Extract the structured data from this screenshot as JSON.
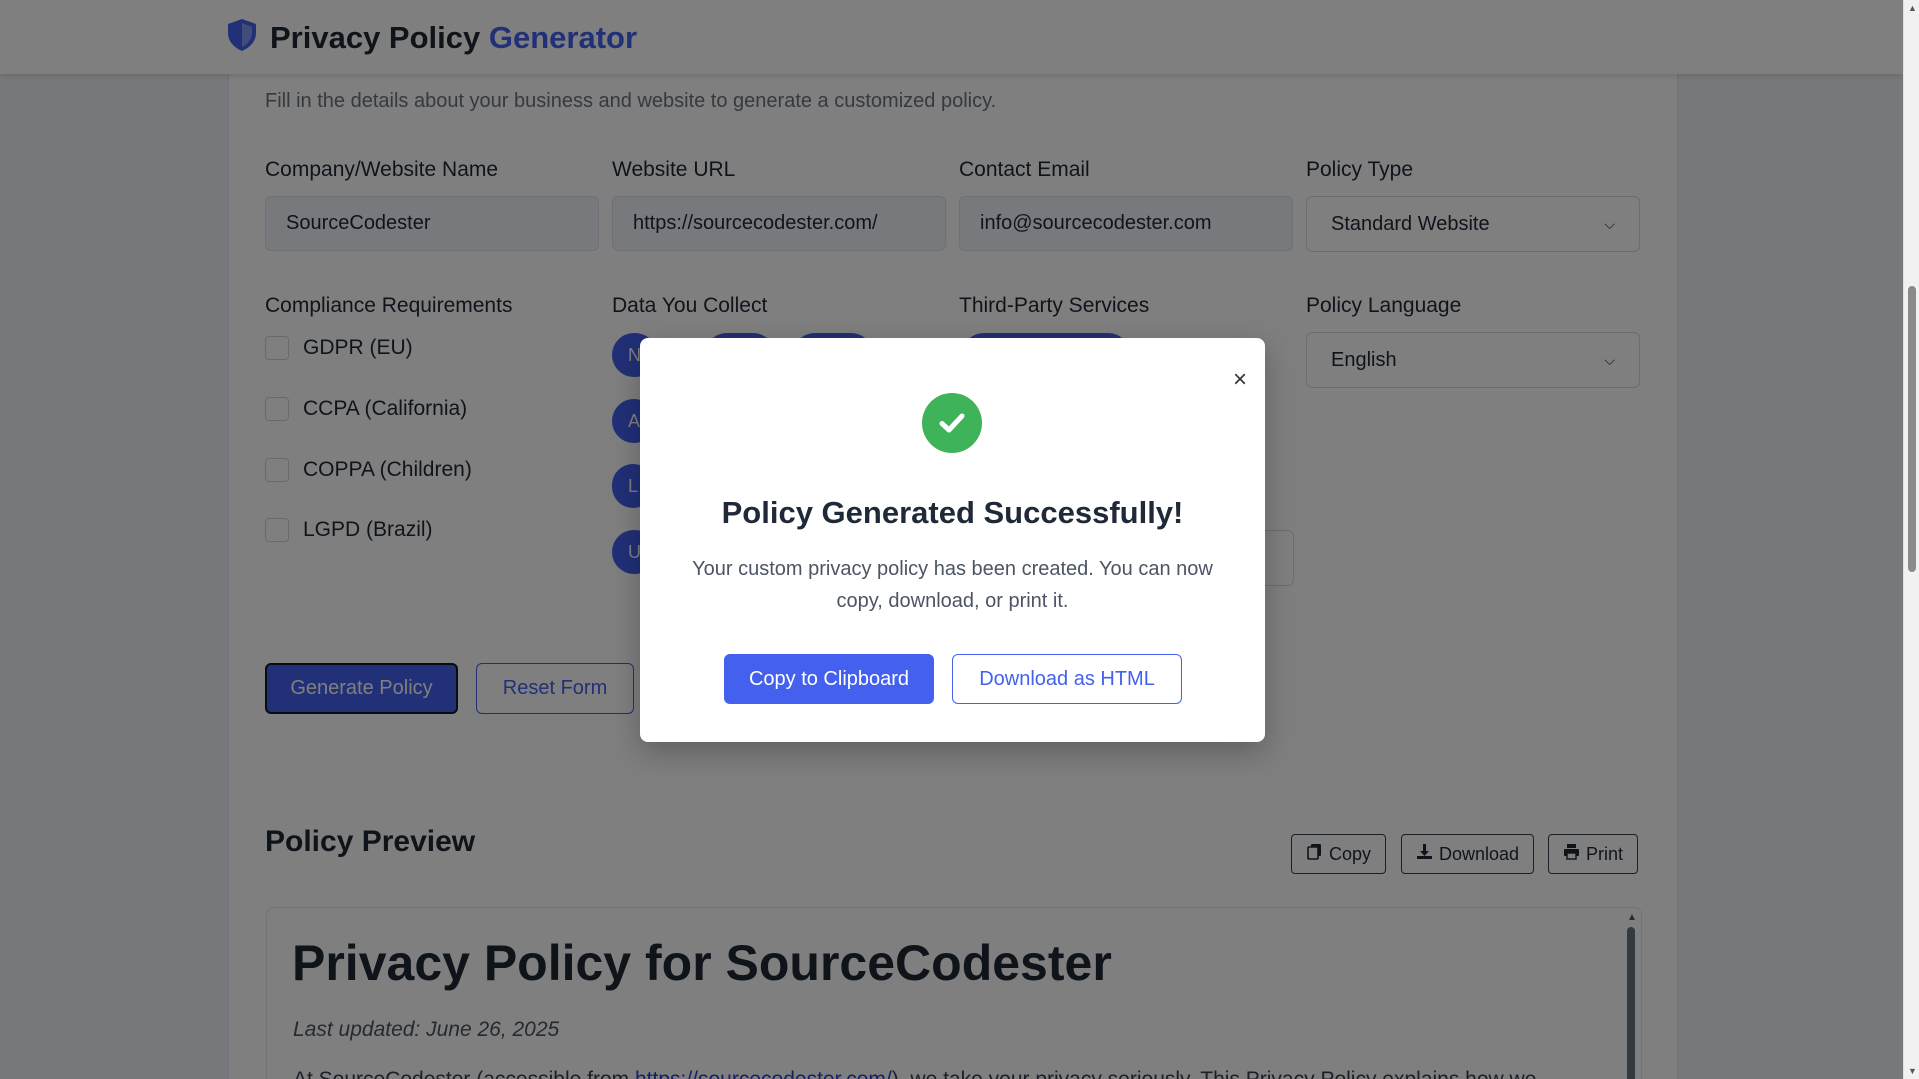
{
  "header": {
    "title_main": "Privacy Policy",
    "title_accent": "Generator"
  },
  "form": {
    "intro": "Fill in the details about your business and website to generate a customized policy.",
    "company": {
      "label": "Company/Website Name",
      "value": "SourceCodester"
    },
    "url": {
      "label": "Website URL",
      "value": "https://sourcecodester.com/"
    },
    "email": {
      "label": "Contact Email",
      "value": "info@sourcecodester.com"
    },
    "policy_type": {
      "label": "Policy Type",
      "selected": "Standard Website"
    },
    "compliance": {
      "label": "Compliance Requirements",
      "items": [
        "GDPR (EU)",
        "CCPA (California)",
        "COPPA (Children)",
        "LGPD (Brazil)"
      ]
    },
    "data_collect": {
      "label": "Data You Collect",
      "pills": [
        "N",
        "A",
        "L",
        "U"
      ]
    },
    "third_party": {
      "label": "Third-Party Services"
    },
    "language": {
      "label": "Policy Language",
      "selected": "English"
    },
    "generate_button": "Generate Policy",
    "reset_button": "Reset Form"
  },
  "preview": {
    "title": "Policy Preview",
    "copy_button": "Copy",
    "download_button": "Download",
    "print_button": "Print",
    "heading": "Privacy Policy for SourceCodester",
    "last_updated": "Last updated: June 26, 2025",
    "para_start": "At SourceCodester (accessible from ",
    "para_link": "https://sourcecodester.com/",
    "para_end": "), we take your privacy seriously. This Privacy Policy explains how we"
  },
  "modal": {
    "title": "Policy Generated Successfully!",
    "text": "Your custom privacy policy has been created. You can now copy, download, or print it.",
    "copy_button": "Copy to Clipboard",
    "download_button": "Download as HTML",
    "close_glyph": "×"
  },
  "colors": {
    "accent": "#4361ee",
    "success": "#3fb35a",
    "overlay": "rgba(0,0,0,0.5)"
  },
  "icons": [
    "shield-icon",
    "copy-icon",
    "download-icon",
    "print-icon",
    "check-icon",
    "close-icon"
  ]
}
